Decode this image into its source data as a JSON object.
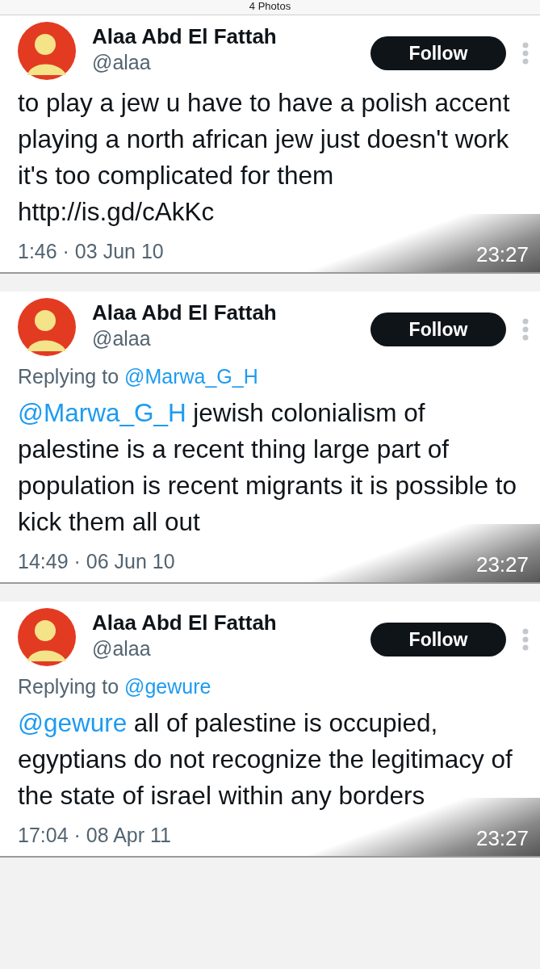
{
  "header": {
    "title": "4 Photos"
  },
  "tweets": [
    {
      "name": "Alaa Abd El Fattah",
      "handle": "@alaa",
      "follow": "Follow",
      "text": "to play a jew u have to have a polish accent playing a north african jew just doesn't work it's too complicated for them http://is.gd/cAkKc",
      "date": "1:46 · 03 Jun 10",
      "overlay_time": "23:27"
    },
    {
      "name": "Alaa Abd El Fattah",
      "handle": "@alaa",
      "follow": "Follow",
      "reply_label": "Replying to",
      "reply_to": "@Marwa_G_H",
      "mention": "@Marwa_G_H",
      "text": "jewish colonialism of palestine is a recent thing large part of population is recent migrants it is possible to kick them all out",
      "date": "14:49 · 06 Jun 10",
      "overlay_time": "23:27"
    },
    {
      "name": "Alaa Abd El Fattah",
      "handle": "@alaa",
      "follow": "Follow",
      "reply_label": "Replying to",
      "reply_to": "@gewure",
      "mention": "@gewure",
      "text": "all of palestine is occupied, egyptians do not recognize the legitimacy of the state of israel within any borders",
      "date": "17:04 · 08 Apr 11",
      "overlay_time": "23:27"
    }
  ]
}
